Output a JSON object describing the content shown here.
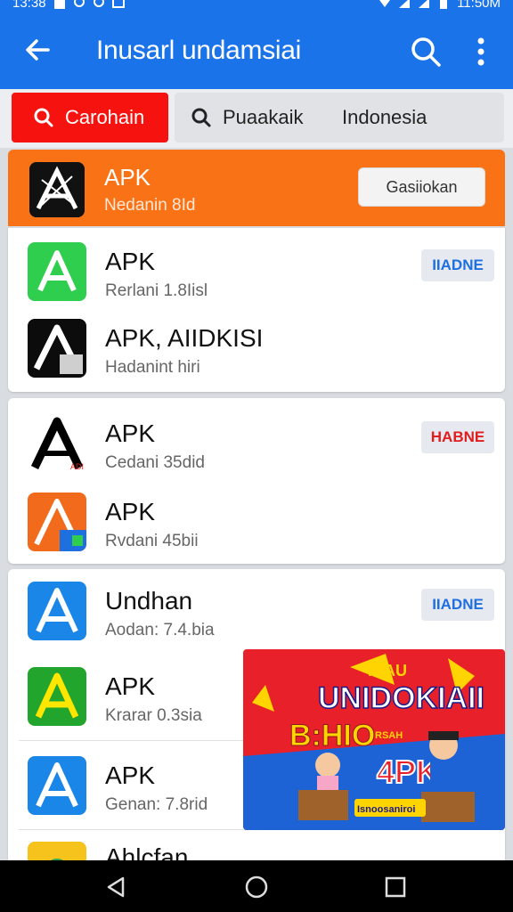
{
  "status_bar": {
    "time_left": "13:38",
    "time_right": "11:50M"
  },
  "app_bar": {
    "title": "Inusarl undamsiai",
    "back_icon": "arrow-left-icon",
    "search_icon": "search-icon",
    "more_icon": "more-vert-icon"
  },
  "filters": {
    "active_label": "Carohain",
    "option1_label": "Puaakaik",
    "option2_label": "Indonesia"
  },
  "featured": {
    "name": "APK",
    "subtitle": "Nedanin 8Id",
    "button_label": "Gasiiokan"
  },
  "groups": [
    {
      "items": [
        {
          "name": "APK",
          "subtitle": "Rerlani 1.8Iisl",
          "badge": "IIADNE",
          "badge_color": "#1e6fe0"
        },
        {
          "name": "APK, AIIDKISI",
          "subtitle": "Hadanint hiri",
          "badge": ""
        }
      ]
    },
    {
      "items": [
        {
          "name": "APK",
          "subtitle": "Cedani 35did",
          "badge": "HABNE",
          "badge_color": "#e01e1e"
        },
        {
          "name": "APK",
          "subtitle": "Rvdani 45bii",
          "badge": ""
        }
      ]
    },
    {
      "items": [
        {
          "name": "Undhan",
          "subtitle": "Aodan: 7.4.bia",
          "badge": "IIADNE",
          "badge_color": "#1e6fe0"
        },
        {
          "name": "APK",
          "subtitle": "Krarar 0.3sia",
          "badge": ""
        },
        {
          "name": "APK",
          "subtitle": "Genan: 7.8rid",
          "badge": ""
        },
        {
          "name": "Ahlcfan",
          "subtitle": "",
          "badge": ""
        }
      ]
    }
  ],
  "banner": {
    "top_text": "HIAU",
    "headline": "UNIDOKIAII",
    "bonus": "B:HIO",
    "small": "RSAH",
    "apk": "4PK",
    "ribbon": "Isnoosaniroi"
  },
  "nav": {
    "back_icon": "triangle-back-icon",
    "home_icon": "circle-home-icon",
    "recents_icon": "square-recents-icon"
  },
  "colors": {
    "primary": "#1a73e8",
    "active_chip": "#f5120f",
    "featured": "#f97316"
  }
}
